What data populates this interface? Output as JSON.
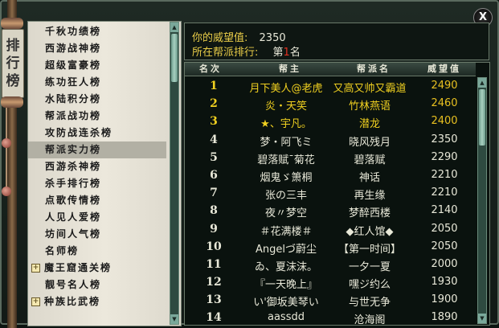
{
  "window": {
    "close_label": "X",
    "title_glyphs": [
      "排",
      "行",
      "榜"
    ]
  },
  "colors": {
    "accent_gold": "#e8cc48",
    "top_rank_gold": "#f0d020",
    "text_light": "#e8e8d8",
    "list_bg": "#e4e0d4",
    "marker_red": "#e03020"
  },
  "sidebar": {
    "items": [
      {
        "label": "千秋功绩榜",
        "selected": false,
        "expandable": false
      },
      {
        "label": "西游战神榜",
        "selected": false,
        "expandable": false
      },
      {
        "label": "超级富豪榜",
        "selected": false,
        "expandable": false
      },
      {
        "label": "练功狂人榜",
        "selected": false,
        "expandable": false
      },
      {
        "label": "水陆积分榜",
        "selected": false,
        "expandable": false
      },
      {
        "label": "帮派战功榜",
        "selected": false,
        "expandable": false
      },
      {
        "label": "攻防战连杀榜",
        "selected": false,
        "expandable": false
      },
      {
        "label": "帮派实力榜",
        "selected": true,
        "expandable": false
      },
      {
        "label": "西游杀神榜",
        "selected": false,
        "expandable": false
      },
      {
        "label": "杀手排行榜",
        "selected": false,
        "expandable": false
      },
      {
        "label": "点歌传情榜",
        "selected": false,
        "expandable": false
      },
      {
        "label": "人见人爱榜",
        "selected": false,
        "expandable": false
      },
      {
        "label": "坊间人气榜",
        "selected": false,
        "expandable": false
      },
      {
        "label": "名师榜",
        "selected": false,
        "expandable": false
      },
      {
        "label": "魔王窟通关榜",
        "selected": false,
        "expandable": true,
        "expand_glyph": "+"
      },
      {
        "label": "靓号名人榜",
        "selected": false,
        "expandable": false
      },
      {
        "label": "种族比武榜",
        "selected": false,
        "expandable": true,
        "expand_glyph": "+"
      }
    ]
  },
  "info": {
    "prestige_label": "你的威望值:",
    "prestige_value": "2350",
    "guild_rank_label": "所在帮派排行:",
    "guild_rank_prefix": "第",
    "guild_rank_marker": "1",
    "guild_rank_suffix": "名"
  },
  "table": {
    "headers": {
      "rank": "名次",
      "leader": "帮主",
      "guild": "帮派名",
      "prestige": "威望值"
    },
    "rows": [
      {
        "rank": "1",
        "leader": "月下美人@老虎",
        "guild": "又高又帅又霸道",
        "prestige": "2490",
        "top": true
      },
      {
        "rank": "2",
        "leader": "炎・天笑",
        "guild": "竹林燕语",
        "prestige": "2460",
        "top": true
      },
      {
        "rank": "3",
        "leader": "★、宇凡。",
        "guild": "潜龙",
        "prestige": "2400",
        "top": true
      },
      {
        "rank": "4",
        "leader": "梦・阿飞ミ",
        "guild": "晓风残月",
        "prestige": "2350",
        "top": false
      },
      {
        "rank": "5",
        "leader": "碧落赋ˉ菊花",
        "guild": "碧落赋",
        "prestige": "2290",
        "top": false
      },
      {
        "rank": "6",
        "leader": "烟鬼ゞ箫桐",
        "guild": "神话",
        "prestige": "2210",
        "top": false
      },
      {
        "rank": "7",
        "leader": "张の三丰",
        "guild": "再生缘",
        "prestige": "2210",
        "top": false
      },
      {
        "rank": "8",
        "leader": "夜〃梦空",
        "guild": "梦醉西楼",
        "prestige": "2140",
        "top": false
      },
      {
        "rank": "9",
        "leader": "＃花满楼＃",
        "guild": "◆红人馆◆",
        "prestige": "2050",
        "top": false
      },
      {
        "rank": "10",
        "leader": "Angelづ蔚尘",
        "guild": "【第一时间】",
        "prestige": "2050",
        "top": false
      },
      {
        "rank": "11",
        "leader": "ゐ、夏沫沫。",
        "guild": "一夕一夏",
        "prestige": "2000",
        "top": false
      },
      {
        "rank": "12",
        "leader": "『一天晚上』",
        "guild": "嘿ジ约么",
        "prestige": "1930",
        "top": false
      },
      {
        "rank": "13",
        "leader": "い'御坂美琴い",
        "guild": "与世无争",
        "prestige": "1900",
        "top": false
      },
      {
        "rank": "14",
        "leader": "aassdd",
        "guild": "沧海阁",
        "prestige": "1890",
        "top": false
      }
    ]
  }
}
